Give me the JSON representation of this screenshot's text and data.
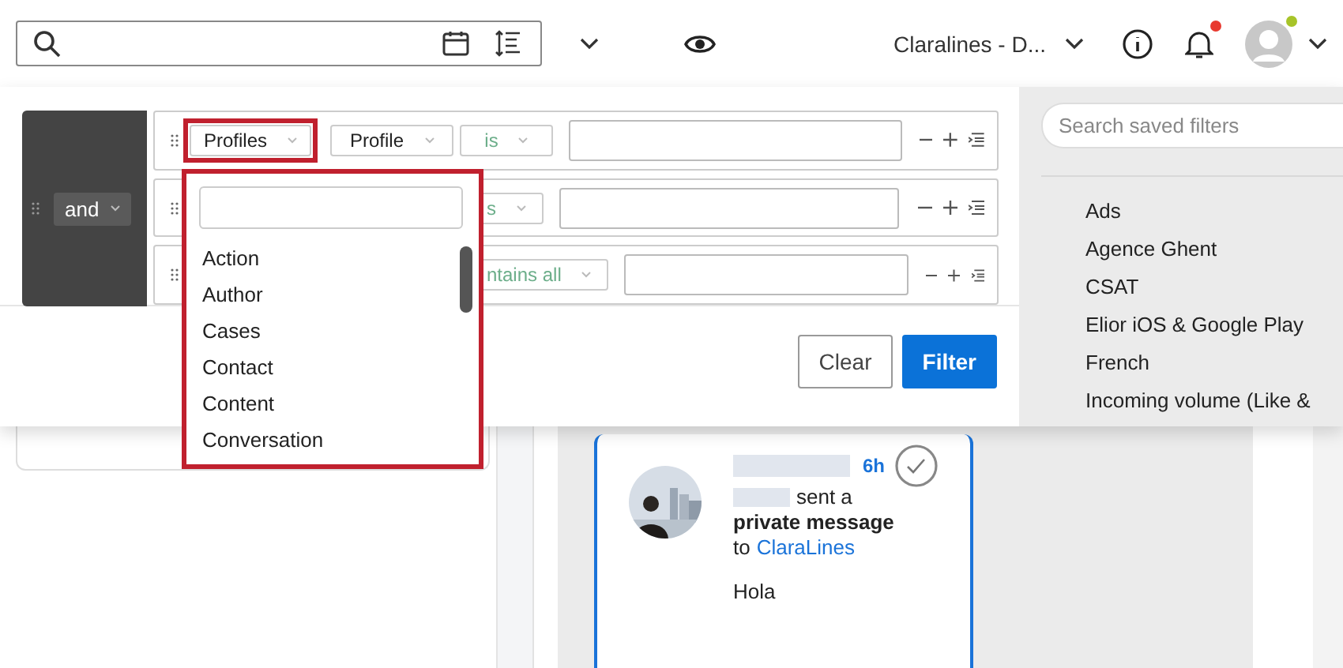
{
  "header": {
    "account": "Claralines - D...",
    "unread_notifications": true,
    "user_online": true
  },
  "filter_panel": {
    "conjunction": "and",
    "rows": [
      {
        "category": "Profiles",
        "field": "Profile",
        "operator": "is",
        "category_highlighted": true
      },
      {
        "operator": "s"
      },
      {
        "operator": "ntains all"
      }
    ],
    "buttons": [
      {
        "label": "Clear",
        "kind": "secondary"
      },
      {
        "label": "Filter",
        "kind": "primary"
      }
    ]
  },
  "dropdown": {
    "highlighted": true,
    "items": [
      "Action",
      "Author",
      "Cases",
      "Contact",
      "Content",
      "Conversation"
    ]
  },
  "saved_filters": {
    "placeholder": "Search saved filters",
    "items": [
      "Ads",
      "Agence Ghent",
      "CSAT",
      "Elior iOS & Google Play",
      "French",
      "Incoming volume (Like &"
    ]
  },
  "post": {
    "time": "6h",
    "action": "sent a",
    "type": "private message",
    "to_prefix": "to",
    "recipient": "ClaraLines",
    "message": "Hola"
  }
}
